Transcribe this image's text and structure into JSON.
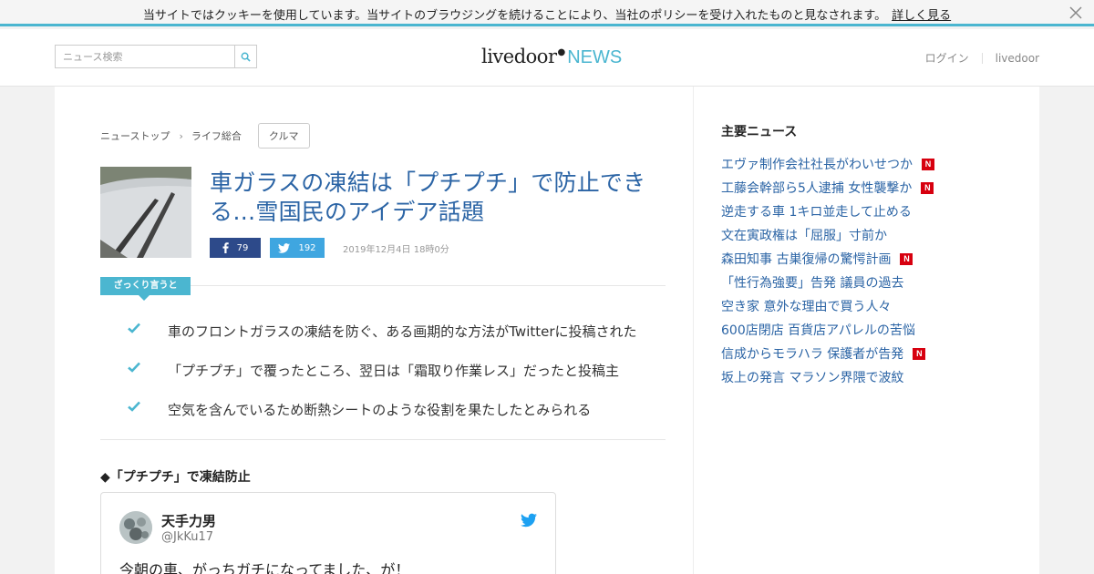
{
  "cookie_bar": {
    "message": "当サイトではクッキーを使用しています。当サイトのブラウジングを続けることにより、当社のポリシーを受け入れたものと見なされます。",
    "link": "詳しく見る",
    "close_icon": "close-icon"
  },
  "header": {
    "search": {
      "placeholder": "ニュース検索",
      "value": ""
    },
    "logo_main": "livedoor",
    "logo_sub": "NEWS",
    "nav": {
      "login": "ログイン",
      "livedoor": "livedoor"
    }
  },
  "breadcrumb": {
    "items": [
      "ニューストップ",
      "ライフ総合"
    ],
    "tag": "クルマ"
  },
  "article": {
    "title": "車ガラスの凍結は「プチプチ」で防止できる…雪国民のアイデア話題",
    "facebook_count": "79",
    "twitter_count": "192",
    "date": "2019年12月4日 18時0分",
    "summary_label": "ざっくり言うと",
    "summary": [
      "車のフロントガラスの凍結を防ぐ、ある画期的な方法がTwitterに投稿された",
      "「プチプチ」で覆ったところ、翌日は「霜取り作業レス」だったと投稿主",
      "空気を含んでいるため断熱シートのような役割を果たしたとみられる"
    ],
    "subheading": "◆「プチプチ」で凍結防止",
    "tweet": {
      "name": "天手力男",
      "handle": "@JkKu17",
      "text": "今朝の車、がっちガチになってました、が！"
    }
  },
  "sidebar": {
    "title": "主要ニュース",
    "badge": "N",
    "items": [
      {
        "label": "エヴァ制作会社社長がわいせつか",
        "new": true
      },
      {
        "label": "工藤会幹部ら5人逮捕 女性襲撃か",
        "new": true
      },
      {
        "label": "逆走する車 1キロ並走して止める",
        "new": false
      },
      {
        "label": "文在寅政権は「屈服」寸前か",
        "new": false
      },
      {
        "label": "森田知事 古巣復帰の驚愕計画",
        "new": true
      },
      {
        "label": "「性行為強要」告発 議員の過去",
        "new": false
      },
      {
        "label": "空き家 意外な理由で買う人々",
        "new": false
      },
      {
        "label": "600店閉店 百貨店アパレルの苦悩",
        "new": false
      },
      {
        "label": "信成からモラハラ 保護者が告発",
        "new": true
      },
      {
        "label": "坂上の発言 マラソン界隈で波紋",
        "new": false
      }
    ]
  },
  "colors": {
    "accent": "#4bb6d0",
    "headline": "#2b64a5",
    "facebook": "#2d4a8a",
    "twitter": "#3fa6e0",
    "new_badge": "#d7000f"
  }
}
